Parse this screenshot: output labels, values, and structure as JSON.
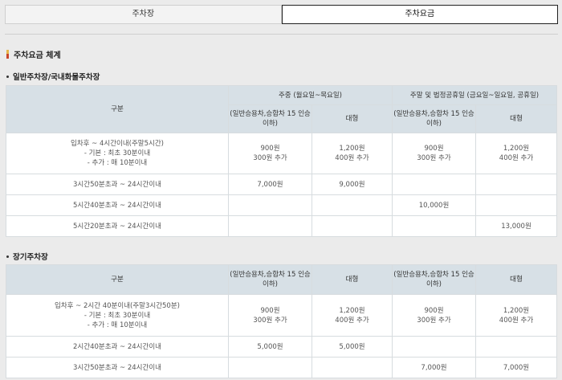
{
  "tabs": [
    {
      "label": "주차장",
      "active": false
    },
    {
      "label": "주차요금",
      "active": true
    }
  ],
  "page_title": "주차요금 체계",
  "sections": [
    {
      "title": "일반주차장/국내화물주차장",
      "col_header": "구분",
      "group_headers": [
        "주중 (월요일~목요일)",
        "주말 및 법정공휴일 (금요일~일요일, 공휴일)"
      ],
      "sub_headers": [
        "(일반승용차,승합차 15 인승이하)",
        "대형",
        "(일반승용차,승합차 15 인승이하)",
        "대형"
      ],
      "rows": [
        {
          "label": [
            "입차후 ~ 4시간이내(주말5시간)",
            "- 기본 : 최초 30분이내",
            "- 추가 : 매 10분이내"
          ],
          "cells": [
            [
              "900원",
              "300원 추가"
            ],
            [
              "1,200원",
              "400원 추가"
            ],
            [
              "900원",
              "300원 추가"
            ],
            [
              "1,200원",
              "400원 추가"
            ]
          ]
        },
        {
          "label": [
            "3시간50분초과 ~ 24시간이내"
          ],
          "cells": [
            [
              "7,000원"
            ],
            [
              "9,000원"
            ],
            [],
            []
          ]
        },
        {
          "label": [
            "5시간40분초과 ~ 24시간이내"
          ],
          "cells": [
            [],
            [],
            [
              "10,000원"
            ],
            []
          ]
        },
        {
          "label": [
            "5시간20분초과 ~ 24시간이내"
          ],
          "cells": [
            [],
            [],
            [],
            [
              "13,000원"
            ]
          ]
        }
      ]
    },
    {
      "title": "장기주차장",
      "col_header": "구분",
      "sub_headers": [
        "(일반승용차,승합차 15 인승이하)",
        "대형",
        "(일반승용차,승합차 15 인승이하)",
        "대형"
      ],
      "rows": [
        {
          "label": [
            "입차후 ~ 2시간 40분이내(주말3시간50분)",
            "- 기본 : 최초 30분이내",
            "- 추가 : 매 10분이내"
          ],
          "cells": [
            [
              "900원",
              "300원 추가"
            ],
            [
              "1,200원",
              "400원 추가"
            ],
            [
              "900원",
              "300원 추가"
            ],
            [
              "1,200원",
              "400원 추가"
            ]
          ]
        },
        {
          "label": [
            "2시간40분초과 ~ 24시간이내"
          ],
          "cells": [
            [
              "5,000원"
            ],
            [
              "5,000원"
            ],
            [],
            []
          ]
        },
        {
          "label": [
            "3시간50분초과 ~ 24시간이내"
          ],
          "cells": [
            [],
            [],
            [
              "7,000원"
            ],
            [
              "7,000원"
            ]
          ]
        }
      ]
    }
  ]
}
